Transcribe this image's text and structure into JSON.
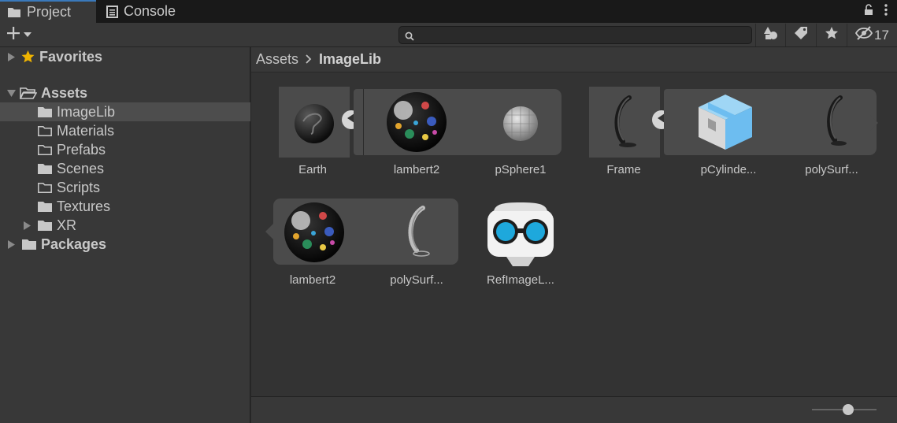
{
  "tabs": [
    {
      "label": "Project",
      "icon": "folder-icon",
      "active": true
    },
    {
      "label": "Console",
      "icon": "console-icon",
      "active": false
    }
  ],
  "toolbar": {
    "search_placeholder": "",
    "hidden_count": "17"
  },
  "tree": {
    "favorites": "Favorites",
    "assets": "Assets",
    "children": [
      "ImageLib",
      "Materials",
      "Prefabs",
      "Scenes",
      "Scripts",
      "Textures",
      "XR"
    ],
    "packages": "Packages",
    "selected": "ImageLib"
  },
  "breadcrumb": {
    "root": "Assets",
    "current": "ImageLib"
  },
  "assets": [
    {
      "label": "Earth",
      "type": "model"
    },
    {
      "label": "lambert2",
      "type": "material"
    },
    {
      "label": "pSphere1",
      "type": "mesh"
    },
    {
      "label": "Frame",
      "type": "model"
    },
    {
      "label": "pCylinde...",
      "type": "prefab"
    },
    {
      "label": "polySurf...",
      "type": "mesh"
    },
    {
      "label": "lambert2",
      "type": "material"
    },
    {
      "label": "polySurf...",
      "type": "mesh"
    },
    {
      "label": "RefImageL...",
      "type": "reference-image-library"
    }
  ],
  "footer": {
    "zoom_level": 0.58
  },
  "colors": {
    "accent": "#3a79bb",
    "selection": "#4d4d4d",
    "favorite_star": "#f0b400",
    "prefab": "#6dbdf0",
    "xr_blue": "#1ea8dc"
  }
}
